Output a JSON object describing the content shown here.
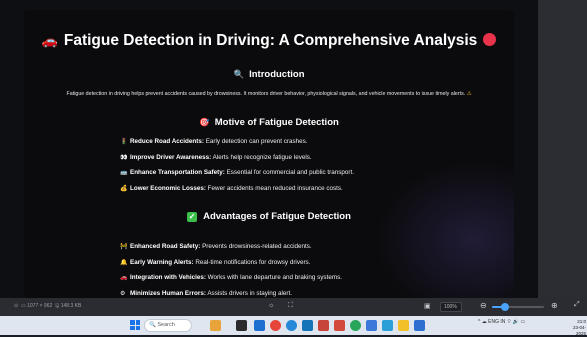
{
  "slide": {
    "title": "Fatigue Detection in Driving: A Comprehensive Analysis",
    "title_emoji": "🚗",
    "intro": {
      "heading": "Introduction",
      "icon": "🔍",
      "text": "Fatigue detection in driving helps prevent accidents caused by drowsiness. It monitors driver behavior, physiological signals, and vehicle movements to issue timely alerts.",
      "warn_icon": "⚠"
    },
    "motive": {
      "heading": "Motive of Fatigue Detection",
      "icon": "🎯",
      "items": [
        {
          "icon": "🚦",
          "bold": "Reduce Road Accidents:",
          "text": " Early detection can prevent crashes."
        },
        {
          "icon": "👀",
          "bold": "Improve Driver Awareness:",
          "text": " Alerts help recognize fatigue levels."
        },
        {
          "icon": "🚌",
          "bold": "Enhance Transportation Safety:",
          "text": " Essential for commercial and public transport."
        },
        {
          "icon": "💰",
          "bold": "Lower Economic Losses:",
          "text": " Fewer accidents mean reduced insurance costs."
        }
      ]
    },
    "advantages": {
      "heading": "Advantages of Fatigue Detection",
      "icon": "✓",
      "items": [
        {
          "icon": "🚧",
          "bold": "Enhanced Road Safety:",
          "text": " Prevents drowsiness-related accidents."
        },
        {
          "icon": "🔔",
          "bold": "Early Warning Alerts:",
          "text": " Real-time notifications for drowsy drivers."
        },
        {
          "icon": "🚗",
          "bold": "Integration with Vehicles:",
          "text": " Works with lane departure and braking systems."
        },
        {
          "icon": "⚙",
          "bold": "Minimizes Human Errors:",
          "text": " Assists drivers in staying alert."
        }
      ]
    }
  },
  "statusbar": {
    "dimensions": "1077 × 962",
    "filesize": "148.3 KB",
    "zoom": "100%",
    "zoom_level": 0.25
  },
  "taskbar": {
    "search_placeholder": "Search",
    "tray_text": "ENG IN",
    "clock_time": "21:0",
    "clock_date": "23-04-2025",
    "accent": "#1a73e8"
  }
}
